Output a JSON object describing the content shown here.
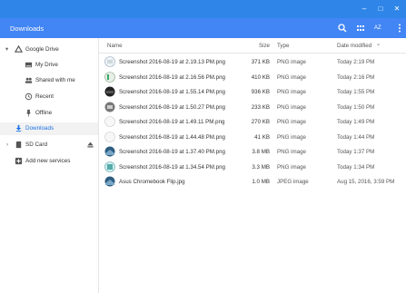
{
  "window": {
    "minimize_glyph": "–",
    "maximize_glyph": "□",
    "close_glyph": "✕"
  },
  "header": {
    "title": "Downloads",
    "sort_label": "AZ",
    "icons": [
      "search-icon",
      "grid-view-icon",
      "sort-icon",
      "more-vert-icon"
    ]
  },
  "sidebar": {
    "items": [
      {
        "label": "Google Drive",
        "icon": "google-drive-icon",
        "expander": "▾"
      },
      {
        "label": "My Drive",
        "icon": "my-drive-icon"
      },
      {
        "label": "Shared with me",
        "icon": "shared-with-me-icon"
      },
      {
        "label": "Recent",
        "icon": "recent-clock-icon"
      },
      {
        "label": "Offline",
        "icon": "offline-pin-icon"
      },
      {
        "label": "Downloads",
        "icon": "download-icon"
      },
      {
        "label": "SD Card",
        "icon": "sd-card-icon",
        "expander": "›",
        "eject": "eject-icon"
      },
      {
        "label": "Add new services",
        "icon": "add-box-icon"
      }
    ]
  },
  "columns": {
    "name": "Name",
    "size": "Size",
    "type": "Type",
    "date": "Date modified",
    "date_sort_glyph": "⌄"
  },
  "files": [
    {
      "name": "Screenshot 2016-08-19 at 2.19.13 PM.png",
      "size": "371 KB",
      "type": "PNG image",
      "date": "Today 2:19 PM",
      "thumb": "light"
    },
    {
      "name": "Screenshot 2016-08-19 at 2.16.56 PM.png",
      "size": "410 KB",
      "type": "PNG image",
      "date": "Today 2:16 PM",
      "thumb": "green"
    },
    {
      "name": "Screenshot 2016-08-19 at 1.55.14 PM.png",
      "size": "936 KB",
      "type": "PNG image",
      "date": "Today 1:55 PM",
      "thumb": "dark"
    },
    {
      "name": "Screenshot 2016-08-19 at 1.50.27 PM.png",
      "size": "233 KB",
      "type": "PNG image",
      "date": "Today 1:50 PM",
      "thumb": "gray"
    },
    {
      "name": "Screenshot 2016-08-19 at 1.49.11 PM.png",
      "size": "270 KB",
      "type": "PNG image",
      "date": "Today 1:49 PM",
      "thumb": "white"
    },
    {
      "name": "Screenshot 2016-08-19 at 1.44.48 PM.png",
      "size": "41 KB",
      "type": "PNG image",
      "date": "Today 1:44 PM",
      "thumb": "white"
    },
    {
      "name": "Screenshot 2016-08-19 at 1.37.40 PM.png",
      "size": "3.8 MB",
      "type": "PNG image",
      "date": "Today 1:37 PM",
      "thumb": "photo"
    },
    {
      "name": "Screenshot 2016-08-19 at 1.34.54 PM.png",
      "size": "3.3 MB",
      "type": "PNG image",
      "date": "Today 1:34 PM",
      "thumb": "teal"
    },
    {
      "name": "Asus Chromebook Flip.jpg",
      "size": "1.0 MB",
      "type": "JPEG image",
      "date": "Aug 15, 2016, 3:59 PM",
      "thumb": "photo"
    }
  ],
  "colors": {
    "titlebar": "#2f86e8",
    "header": "#4285f4",
    "active_text": "#1a73e8"
  }
}
